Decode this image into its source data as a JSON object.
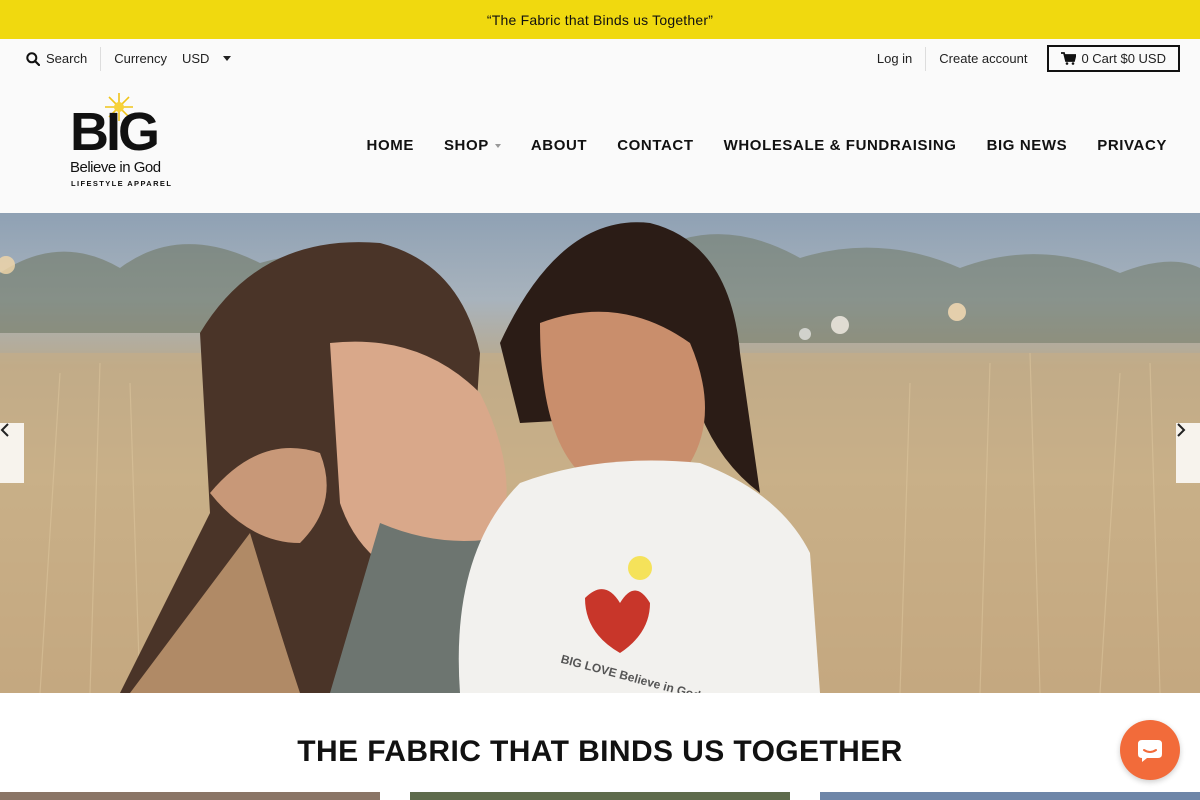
{
  "announcement": "“The Fabric that Binds us Together”",
  "topbar": {
    "search_label": "Search",
    "currency_label": "Currency",
    "currency_value": "USD",
    "login": "Log in",
    "create_account": "Create account",
    "cart": "0 Cart $0 USD"
  },
  "logo": {
    "text": "BIG",
    "tagline": "Believe in God",
    "subtitle": "LIFESTYLE APPAREL"
  },
  "nav": {
    "items": [
      {
        "label": "HOME"
      },
      {
        "label": "SHOP"
      },
      {
        "label": "ABOUT"
      },
      {
        "label": "CONTACT"
      },
      {
        "label": "WHOLESALE & FUNDRAISING"
      },
      {
        "label": "BIG NEWS"
      },
      {
        "label": "PRIVACY"
      }
    ]
  },
  "hero": {
    "image": "mother-and-daughter-in-field-photo",
    "shirt_text": "BIG LOVE Believe in God"
  },
  "section": {
    "title": "THE FABRIC THAT BINDS US TOGETHER"
  },
  "colors": {
    "announcement_bg": "#f0d90f",
    "chat_bg": "#f26b3a",
    "header_bg": "#fafafa"
  },
  "icons": {
    "search": "search-icon",
    "cart": "cart-icon",
    "prev": "chevron-left-icon",
    "next": "chevron-right-icon",
    "chat": "chat-icon"
  }
}
